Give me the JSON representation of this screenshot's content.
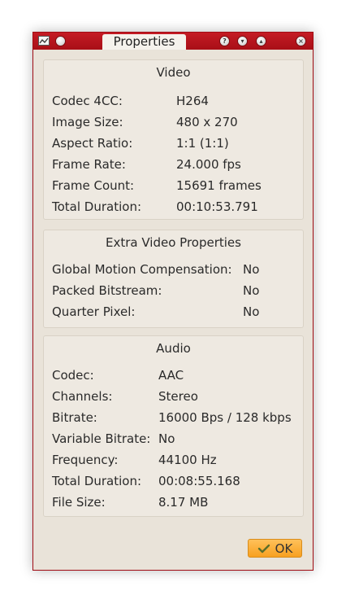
{
  "window": {
    "title": "Properties"
  },
  "titlebar_buttons": {
    "help": "?",
    "minimize": "▾",
    "maximize": "▴",
    "close": "×"
  },
  "video": {
    "title": "Video",
    "rows": [
      {
        "label": "Codec 4CC:",
        "value": "H264"
      },
      {
        "label": "Image Size:",
        "value": "480 x 270"
      },
      {
        "label": "Aspect Ratio:",
        "value": "1:1 (1:1)"
      },
      {
        "label": "Frame Rate:",
        "value": "24.000 fps"
      },
      {
        "label": "Frame Count:",
        "value": "15691 frames"
      },
      {
        "label": "Total Duration:",
        "value": "00:10:53.791"
      }
    ]
  },
  "extra": {
    "title": "Extra Video Properties",
    "rows": [
      {
        "label": "Global Motion Compensation:",
        "value": "No"
      },
      {
        "label": "Packed Bitstream:",
        "value": "No"
      },
      {
        "label": "Quarter Pixel:",
        "value": "No"
      }
    ]
  },
  "audio": {
    "title": "Audio",
    "rows": [
      {
        "label": "Codec:",
        "value": "AAC"
      },
      {
        "label": "Channels:",
        "value": "Stereo"
      },
      {
        "label": "Bitrate:",
        "value": "16000 Bps / 128 kbps"
      },
      {
        "label": "Variable Bitrate:",
        "value": "No"
      },
      {
        "label": "Frequency:",
        "value": "44100 Hz"
      },
      {
        "label": "Total Duration:",
        "value": "00:08:55.168"
      },
      {
        "label": "File Size:",
        "value": "8.17 MB"
      }
    ]
  },
  "ok_button": {
    "label": "OK"
  },
  "colors": {
    "titlebar": "#b5121b",
    "ok_button": "#f9a62a",
    "body": "#e9e3d9"
  }
}
